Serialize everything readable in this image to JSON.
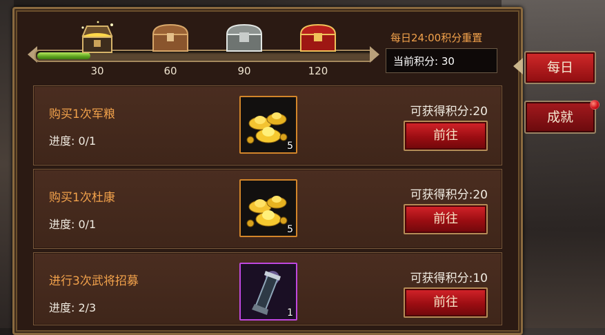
{
  "header": {
    "reset_text": "每日24:00积分重置",
    "score_label": "当前积分:",
    "score_value": "30",
    "progress_fraction": 0.16,
    "milestones": [
      {
        "value": "30",
        "chest": "gold-chest-open-icon"
      },
      {
        "value": "60",
        "chest": "wooden-chest-icon"
      },
      {
        "value": "90",
        "chest": "silver-chest-icon"
      },
      {
        "value": "120",
        "chest": "red-chest-icon"
      }
    ]
  },
  "tasks": [
    {
      "title": "购买1次军粮",
      "progress": "进度: 0/1",
      "points": "可获得积分:20",
      "reward_icon": "gold-ingots-icon",
      "reward_count": "5",
      "button": "前往"
    },
    {
      "title": "购买1次杜康",
      "progress": "进度: 0/1",
      "points": "可获得积分:20",
      "reward_icon": "gold-ingots-icon",
      "reward_count": "5",
      "button": "前往"
    },
    {
      "title": "进行3次武将招募",
      "progress": "进度: 2/3",
      "points": "可获得积分:10",
      "reward_icon": "recruit-scroll-icon",
      "reward_count": "1",
      "button": "前往"
    }
  ],
  "tabs": {
    "daily": "每日",
    "achievement": "成就"
  },
  "colors": {
    "accent_orange": "#f2a24b",
    "button_red": "#b5141a",
    "progress_green": "#5ca21f"
  }
}
